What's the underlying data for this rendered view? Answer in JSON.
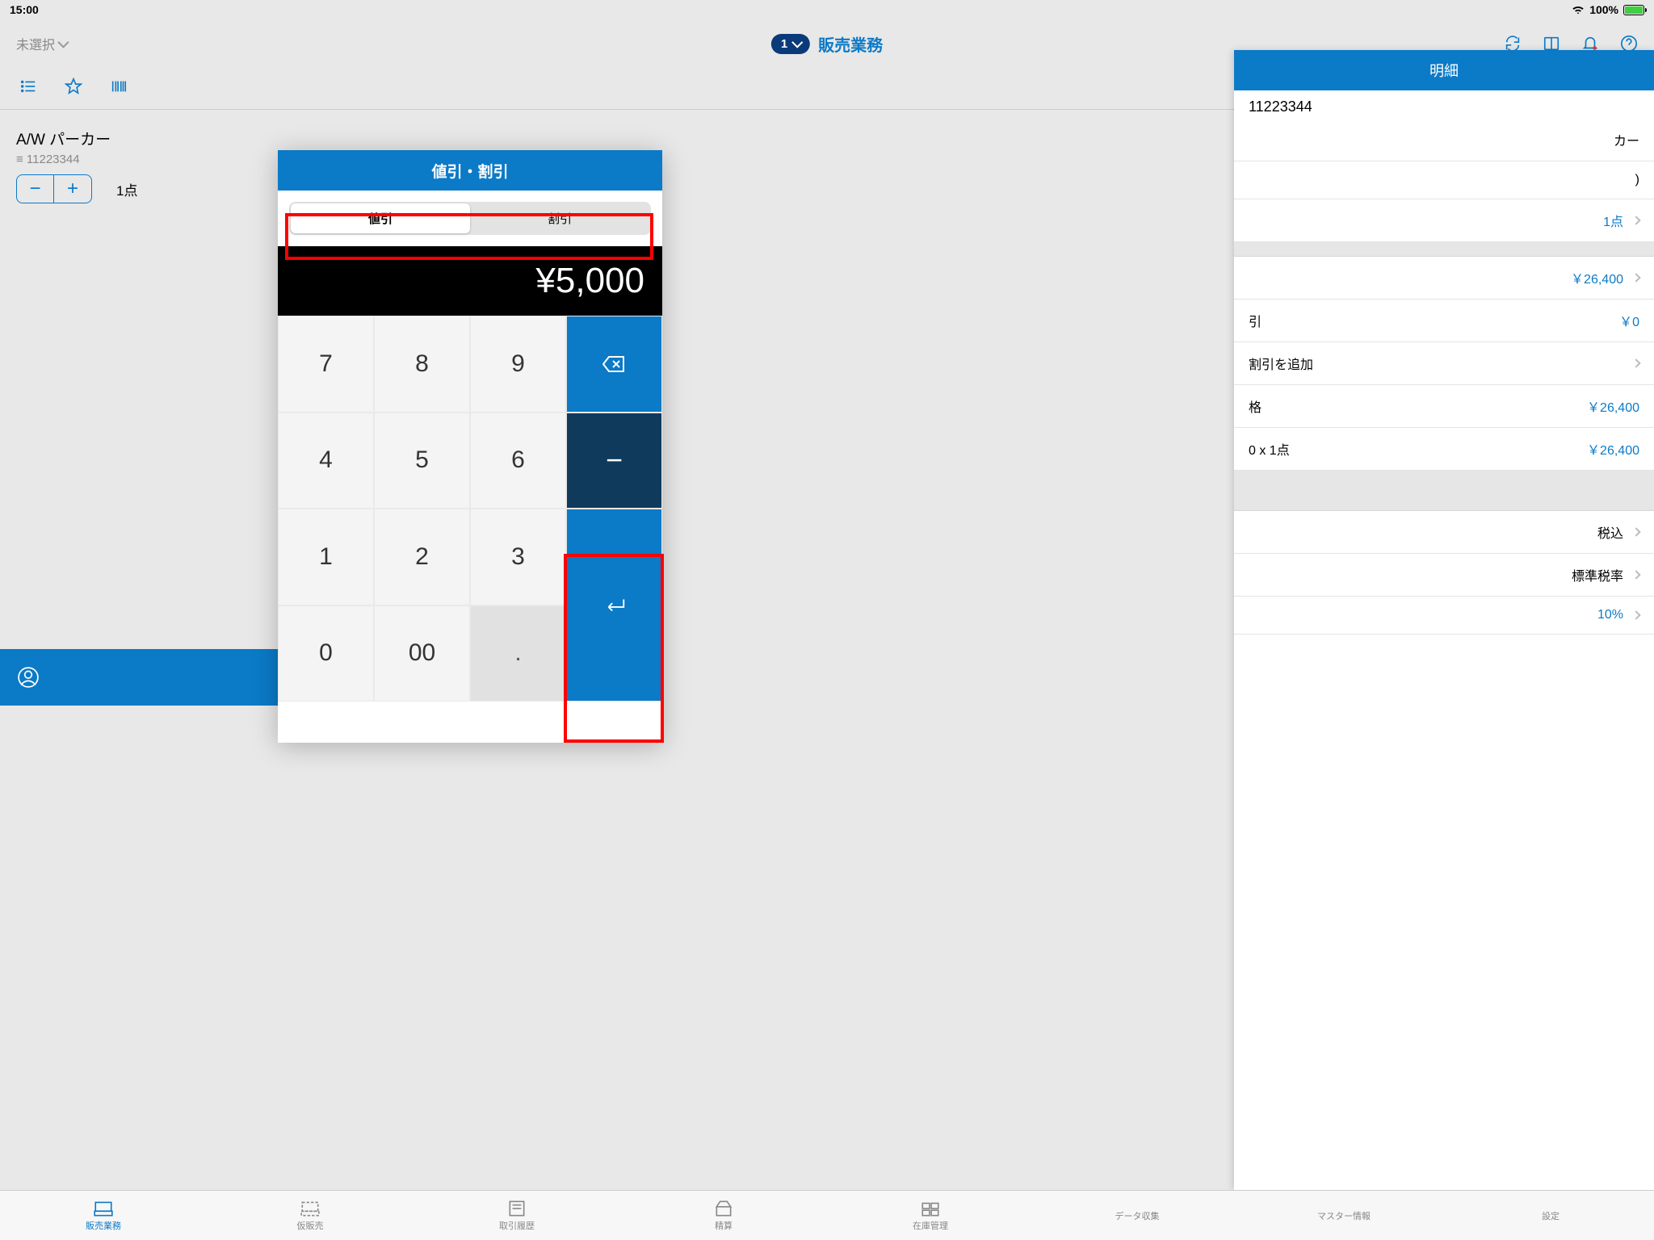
{
  "status": {
    "time": "15:00",
    "battery": "100%"
  },
  "top": {
    "selector": "未選択",
    "badge": "1",
    "title": "販売業務"
  },
  "item": {
    "name": "A/W パーカー",
    "code": "11223344",
    "qty_label": "1点"
  },
  "detail": {
    "header": "明細",
    "sku": "11223344",
    "name_partial": "カー",
    "qty": "1点",
    "price": "￥26,400",
    "discount_label": "引",
    "discount_val": "￥0",
    "add_discount": "割引を追加",
    "kakaku_label": "格",
    "kakaku_val": "￥26,400",
    "calc_label": "0 x 1点",
    "calc_val": "￥26,400",
    "tax_incl": "税込",
    "tax_rate_label": "標準税率",
    "tax_pct": "10%"
  },
  "modal": {
    "title": "値引・割引",
    "tab_discount_amount": "値引",
    "tab_discount_pct": "割引",
    "display": "¥5,000",
    "keys": {
      "k7": "7",
      "k8": "8",
      "k9": "9",
      "k4": "4",
      "k5": "5",
      "k6": "6",
      "k1": "1",
      "k2": "2",
      "k3": "3",
      "k0": "0",
      "k00": "00",
      "kdot": "."
    }
  },
  "tabs": {
    "t1": "販売業務",
    "t2": "仮販売",
    "t3": "取引履歴",
    "t4": "精算",
    "t5": "在庫管理",
    "t6": "データ収集",
    "t7": "マスター情報",
    "t8": "設定"
  }
}
